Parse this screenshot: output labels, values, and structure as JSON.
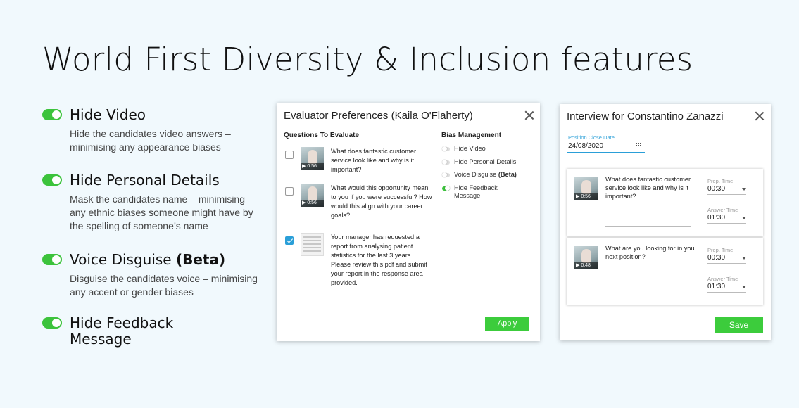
{
  "headline": "World First Diversity & Inclusion features",
  "features": [
    {
      "name": "Hide Video",
      "desc": "Hide the candidates video answers – minimising any appearance biases"
    },
    {
      "name": "Hide Personal Details",
      "desc": "Mask the candidates name – minimising any ethnic biases someone might have by the spelling of someone’s name"
    },
    {
      "name": "Voice Disguise",
      "beta": "(Beta)",
      "desc": "Disguise the candidates voice – minimising any accent or gender biases"
    },
    {
      "name_line1": "Hide Feedback",
      "name_line2": "Message"
    }
  ],
  "evaluator": {
    "title": "Evaluator Preferences (Kaila O'Flaherty)",
    "questions_heading": "Questions To Evaluate",
    "questions": [
      {
        "text": "What does fantastic customer service look like and why is it important?",
        "duration": "0:56",
        "checked": false
      },
      {
        "text": "What would this opportunity mean to you if you were successful? How would this align with your career goals?",
        "duration": "0:56",
        "checked": false
      },
      {
        "text": "Your manager has requested a report from analysing patient statistics for the last 3 years. Please review this pdf and submit your report in the response area provided.",
        "checked": true
      }
    ],
    "bias_heading": "Bias Management",
    "bias": {
      "hide_video": "Hide Video",
      "hide_personal": "Hide Personal Details",
      "voice": "Voice Disguise",
      "voice_beta": "(Beta)",
      "feedback": "Hide Feedback Message"
    },
    "apply_label": "Apply"
  },
  "interview": {
    "title": "Interview for Constantino Zanazzi",
    "close_date_label": "Position Close Date",
    "close_date_value": "24/08/2020",
    "cards": [
      {
        "question": "What does fantastic customer service look like and why is it important?",
        "duration": "0:56",
        "prep_label": "Prep. Time",
        "prep_value": "00:30",
        "answer_label": "Answer Time",
        "answer_value": "01:30"
      },
      {
        "question": "What are you looking for in you next position?",
        "duration": "0:48",
        "prep_label": "Prep. Time",
        "prep_value": "00:30",
        "answer_label": "Answer Time",
        "answer_value": "01:30"
      }
    ],
    "save_label": "Save"
  },
  "colors": {
    "accent_green": "#3ccc3c",
    "accent_blue": "#2a9fd8",
    "background": "#f1f9fd"
  },
  "icons": [
    "toggle-on-icon",
    "close-icon",
    "calendar-icon",
    "play-icon",
    "chevron-down-icon",
    "checkbox-icon"
  ]
}
